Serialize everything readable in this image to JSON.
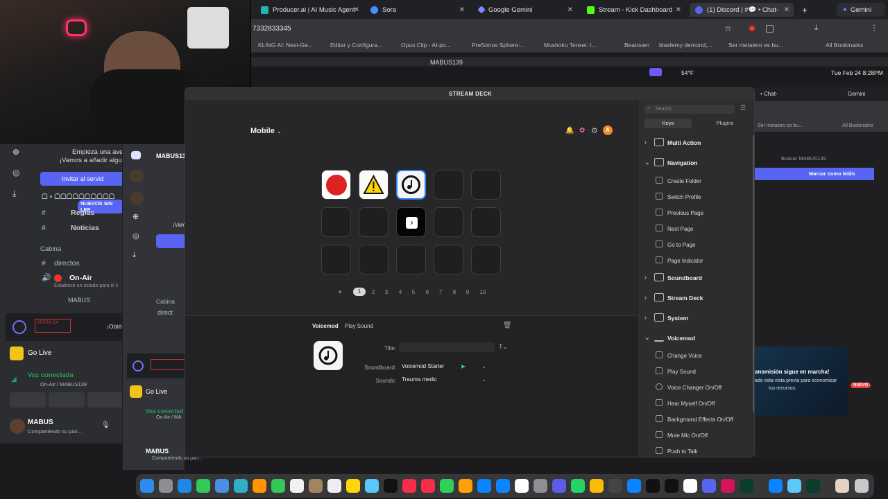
{
  "browser": {
    "tabs": [
      {
        "label": "Producer.ai | AI Music Agent",
        "color": "#23b3b5"
      },
      {
        "label": "Sora",
        "color": "#4a8cff"
      },
      {
        "label": "Google Gemini",
        "color": "#7b8cff"
      },
      {
        "label": "Stream - Kick Dashboard",
        "color": "#53fc18"
      },
      {
        "label": "(1) Discord | #💬 • Chat-",
        "color": "#5865f2"
      }
    ],
    "gemini_tab": "Gemini",
    "address": "7332833345",
    "bookmarks": [
      "KLING AI: Next-Ge...",
      "Editar y Configura...",
      "Opus Clip - AI-po...",
      "PreSonus Sphere:...",
      "Mushoku Tensei: I...",
      "Beatoven",
      "blasfemy demond,...",
      "Ser metalero es bu..."
    ],
    "all_bookmarks": "All Bookmarks",
    "window_title": "MABUS139",
    "menubar": {
      "temp": "54°F",
      "datetime": "Tue Feb 24  8:28PM"
    }
  },
  "discord_a": {
    "promo_line1": "Empieza una aven",
    "promo_line2": "¡Vamos a añadir algunc",
    "invite_btn": "Invitar al servid",
    "unread": "NUEVOS SIN LEE",
    "channels": [
      "ᗝ • ᗝᗝᗝᗝᗝᗝᗝᗝᗝᗝ",
      "Reglas",
      "Noticias"
    ],
    "category": "Cabina",
    "chan_directos": "directos",
    "voice_channel": "On-Air",
    "voice_status": "Establece un estado para el c",
    "voice_user": "MABUS",
    "banner_text": "¡Obtén",
    "go_live": "Go Live",
    "voice_connected": "Voz conectada",
    "voice_path": "On-Air / MABUS139",
    "user_name": "MABUS",
    "user_status": "Compartiendo su pan..."
  },
  "discord_b": {
    "server_name": "MABUS13",
    "vam": "¡Vam",
    "category": "Cabina",
    "directos": "direct",
    "go_live": "Go Live",
    "voice_connected": "Voz conectad",
    "voice_path": "On-Air / MA",
    "user_name": "MABUS",
    "user_status": "Compartiendo su pan..."
  },
  "streamdeck": {
    "title": "STREAM DECK",
    "profile": "Mobile",
    "avatar_letter": "A",
    "pages": [
      "1",
      "2",
      "3",
      "4",
      "5",
      "6",
      "7",
      "8",
      "9",
      "10"
    ],
    "current_page": "1",
    "action_title": "Voicemod",
    "action_sub": "Play Sound",
    "fields": {
      "title_label": "Title:",
      "title_value": "",
      "soundboard_label": "Soundboard:",
      "soundboard_value": "Voicemod Starter",
      "sounds_label": "Sounds:",
      "sounds_value": "Trauma medic"
    },
    "search_placeholder": "Search",
    "side_tabs": [
      "Keys",
      "Plugins"
    ],
    "categories": {
      "multi": "Multi Action",
      "navigation": "Navigation",
      "soundboard": "Soundboard",
      "streamdeck": "Stream Deck",
      "system": "System",
      "voicemod": "Voicemod"
    },
    "nav_actions": [
      "Create Folder",
      "Switch Profile",
      "Previous Page",
      "Next Page",
      "Go to Page",
      "Page Indicator"
    ],
    "voicemod_actions": [
      "Change Voice",
      "Play Sound",
      "Voice Changer On/Off",
      "Hear Myself On/Off",
      "Background Effects On/Off",
      "Mute Mic On/Off",
      "Push to Talk"
    ]
  },
  "right_fragment": {
    "chat_tab": "• Chat-",
    "gemini": "Gemini",
    "metalero": "Ser metalero es bu...",
    "all_bookmarks": "All Bookmarks",
    "search": "Buscar MABUS139",
    "mark_read": "Marcar como leído",
    "stream_title": "ansmisión sigue en marcha!",
    "stream_desc1": "ado esta vista previa para economizar",
    "stream_desc2": "tus recursos.",
    "badge": "NUEVO"
  },
  "accent": "#2b82f7"
}
